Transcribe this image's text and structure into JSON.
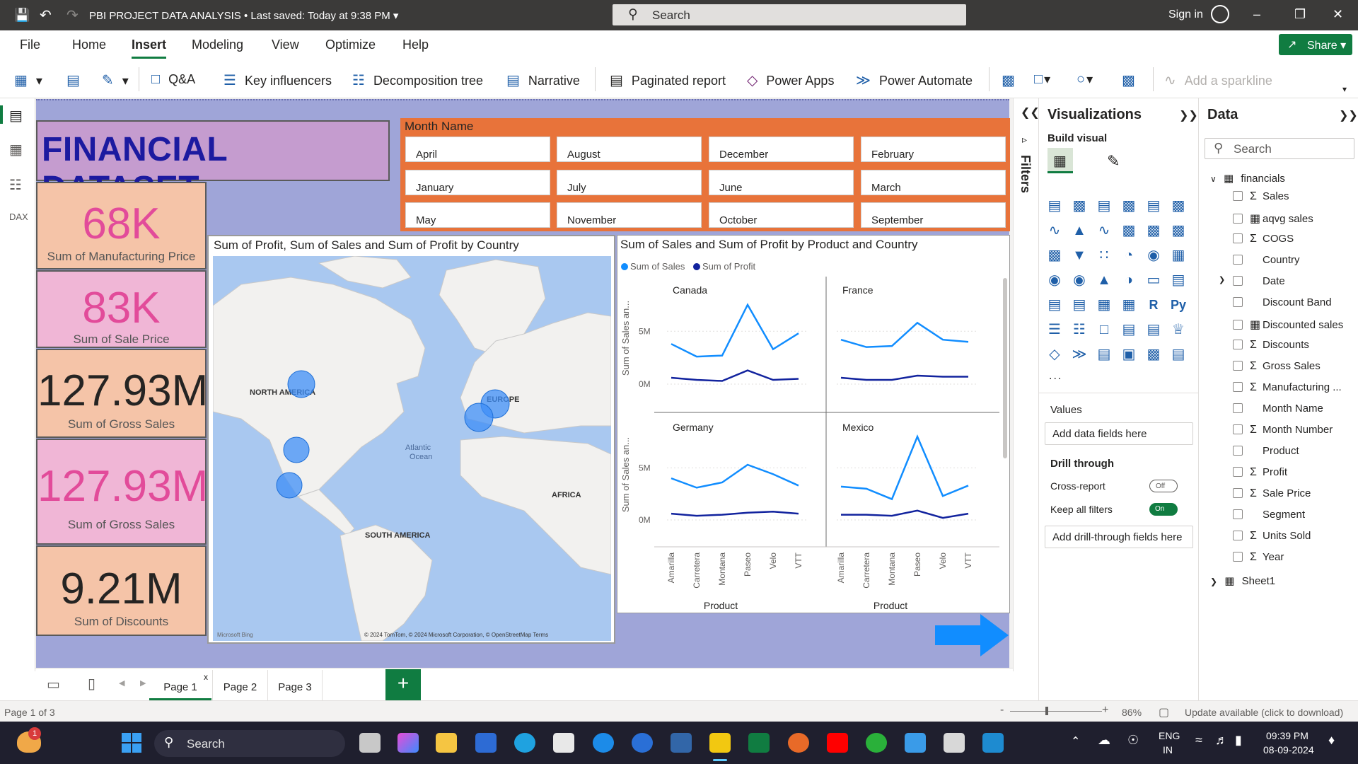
{
  "titlebar": {
    "title": "PBI PROJECT DATA ANALYSIS",
    "saved": "Last saved: Today at 9:38 PM",
    "search_placeholder": "Search",
    "signin": "Sign in"
  },
  "menu": {
    "items": [
      "File",
      "Home",
      "Insert",
      "Modeling",
      "View",
      "Optimize",
      "Help"
    ],
    "active": "Insert",
    "share": "Share"
  },
  "ribbon": {
    "qa": "Q&A",
    "key_influencers": "Key influencers",
    "decomposition_tree": "Decomposition tree",
    "narrative": "Narrative",
    "paginated_report": "Paginated report",
    "power_apps": "Power Apps",
    "power_automate": "Power Automate",
    "add_sparkline": "Add a sparkline"
  },
  "report": {
    "title": "FINANCIAL DATASET",
    "kpis": [
      {
        "value": "68K",
        "label": "Sum of Manufacturing Price",
        "color": "#e24b9a",
        "bg": "#f5c4a8"
      },
      {
        "value": "83K",
        "label": "Sum of Sale Price",
        "color": "#e24b9a",
        "bg": "#f0b6d6"
      },
      {
        "value": "127.93M",
        "label": "Sum of Gross Sales",
        "color": "#252423",
        "bg": "#f5c4a8"
      },
      {
        "value": "127.93M",
        "label": "Sum of Gross Sales",
        "color": "#e24b9a",
        "bg": "#f0b6d6"
      },
      {
        "value": "9.21M",
        "label": "Sum of Discounts",
        "color": "#252423",
        "bg": "#f5c4a8"
      }
    ],
    "slicer": {
      "header": "Month Name",
      "months": [
        "April",
        "August",
        "December",
        "February",
        "January",
        "July",
        "June",
        "March",
        "May",
        "November",
        "October",
        "September"
      ]
    },
    "map": {
      "title": "Sum of Profit, Sum of Sales and Sum of Profit by Country",
      "labels": {
        "north_america": "NORTH AMERICA",
        "europe": "EUROPE",
        "africa": "AFRICA",
        "south_america": "SOUTH AMERICA",
        "atlantic": "Atlantic",
        "ocean": "Ocean"
      },
      "attribution": "© 2024 TomTom, © 2024 Microsoft Corporation, © OpenStreetMap  Terms",
      "bing": "Microsoft Bing"
    },
    "linechart": {
      "title": "Sum of Sales and Sum of Profit by Product and Country",
      "legend": [
        "Sum of  Sales",
        "Sum of Profit"
      ],
      "colors": {
        "sales": "#118dff",
        "profit": "#12239e"
      },
      "ylabel": "Sum of Sales an...",
      "xlabel": "Product",
      "yticks": [
        "5M",
        "0M"
      ]
    }
  },
  "chart_data": {
    "type": "line",
    "title": "Sum of Sales and Sum of Profit by Product and Country",
    "categories": [
      "Amarilla",
      "Carretera",
      "Montana",
      "Paseo",
      "Velo",
      "VTT"
    ],
    "xlabel": "Product",
    "ylabel": "Sum of Sales an...",
    "ylim": [
      0,
      8
    ],
    "legend_placement": "top-left",
    "panels": [
      {
        "name": "Canada",
        "series": [
          {
            "name": "Sum of  Sales",
            "values": [
              3.8,
              2.6,
              2.7,
              7.5,
              3.3,
              4.8
            ]
          },
          {
            "name": "Sum of Profit",
            "values": [
              0.6,
              0.4,
              0.3,
              1.3,
              0.4,
              0.5
            ]
          }
        ]
      },
      {
        "name": "France",
        "series": [
          {
            "name": "Sum of  Sales",
            "values": [
              4.2,
              3.5,
              3.6,
              5.8,
              4.2,
              4.0
            ]
          },
          {
            "name": "Sum of Profit",
            "values": [
              0.6,
              0.4,
              0.4,
              0.8,
              0.7,
              0.7
            ]
          }
        ]
      },
      {
        "name": "Germany",
        "series": [
          {
            "name": "Sum of  Sales",
            "values": [
              4.0,
              3.1,
              3.6,
              5.3,
              4.4,
              3.3
            ]
          },
          {
            "name": "Sum of Profit",
            "values": [
              0.6,
              0.4,
              0.5,
              0.7,
              0.8,
              0.6
            ]
          }
        ]
      },
      {
        "name": "Mexico",
        "series": [
          {
            "name": "Sum of  Sales",
            "values": [
              3.2,
              3.0,
              2.0,
              8.0,
              2.3,
              3.3
            ]
          },
          {
            "name": "Sum of Profit",
            "values": [
              0.5,
              0.5,
              0.4,
              0.9,
              0.2,
              0.6
            ]
          }
        ]
      }
    ]
  },
  "pages": {
    "tabs": [
      "Page 1",
      "Page 2",
      "Page 3"
    ],
    "active": "Page 1",
    "close": "x",
    "add": "+"
  },
  "status": {
    "page_info": "Page 1 of 3",
    "zoom": "86%",
    "update": "Update available (click to download)"
  },
  "filters": {
    "label": "Filters"
  },
  "visualizations": {
    "title": "Visualizations",
    "build_visual": "Build visual",
    "values": "Values",
    "values_well": "Add data fields here",
    "drill_through": "Drill through",
    "cross_report": "Cross-report",
    "cross_report_state": "Off",
    "keep_filters": "Keep all filters",
    "keep_filters_state": "On",
    "drill_well": "Add drill-through fields here",
    "more": "..."
  },
  "data": {
    "title": "Data",
    "search_placeholder": "Search",
    "table": "financials",
    "fields": [
      {
        "name": "Sales",
        "sigma": true
      },
      {
        "name": "aqvg sales",
        "sigma": false,
        "calc": true
      },
      {
        "name": "COGS",
        "sigma": true
      },
      {
        "name": "Country",
        "sigma": false
      },
      {
        "name": "Date",
        "sigma": false,
        "date": true
      },
      {
        "name": "Discount Band",
        "sigma": false
      },
      {
        "name": "Discounted sales",
        "sigma": false,
        "calc": true
      },
      {
        "name": "Discounts",
        "sigma": true
      },
      {
        "name": "Gross Sales",
        "sigma": true
      },
      {
        "name": "Manufacturing ...",
        "sigma": true
      },
      {
        "name": "Month Name",
        "sigma": false
      },
      {
        "name": "Month Number",
        "sigma": true
      },
      {
        "name": "Product",
        "sigma": false
      },
      {
        "name": "Profit",
        "sigma": true
      },
      {
        "name": "Sale Price",
        "sigma": true
      },
      {
        "name": "Segment",
        "sigma": false
      },
      {
        "name": "Units Sold",
        "sigma": true
      },
      {
        "name": "Year",
        "sigma": true
      }
    ],
    "table2": "Sheet1"
  },
  "taskbar": {
    "search": "Search",
    "lang1": "ENG",
    "lang2": "IN",
    "time": "09:39 PM",
    "date": "08-09-2024",
    "badge": "1"
  }
}
